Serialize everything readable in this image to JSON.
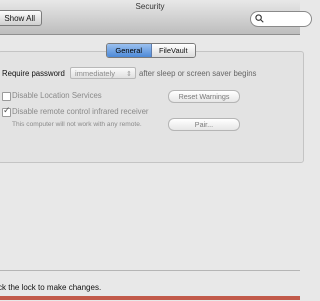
{
  "window": {
    "title": "Security"
  },
  "toolbar": {
    "show_all": "Show All",
    "search": {
      "placeholder": ""
    }
  },
  "tabs": [
    {
      "label": "General",
      "selected": true
    },
    {
      "label": "FileVault",
      "selected": false
    }
  ],
  "general": {
    "require_password": {
      "label": "Require password",
      "selected_value": "immediately",
      "suffix": "after sleep or screen saver begins"
    },
    "disable_location_services": {
      "label": "Disable Location Services",
      "checked": false
    },
    "reset_warnings_button": "Reset Warnings",
    "disable_remote_ir": {
      "label": "Disable remote control infrared receiver",
      "checked": true,
      "note": "This computer will not work with any remote."
    },
    "pair_button": "Pair..."
  },
  "footer": {
    "lock_text": "ck the lock to make changes."
  },
  "colors": {
    "accent": "#4d8ad8",
    "strip": "#c25a4a"
  }
}
